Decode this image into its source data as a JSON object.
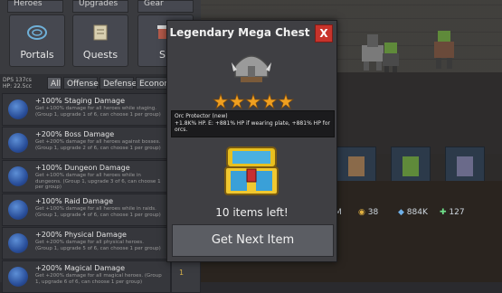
{
  "nav": {
    "top": [
      "Heroes",
      "Upgrades",
      "Gear"
    ],
    "tiles": [
      {
        "label": "Portals",
        "icon": "portal-icon"
      },
      {
        "label": "Quests",
        "icon": "scroll-icon"
      },
      {
        "label": "Sh",
        "icon": "shop-icon"
      }
    ]
  },
  "stats": {
    "l1": "DPS",
    "v1": "137cs",
    "l2": "HP:",
    "v2": "22.5cc"
  },
  "filters": [
    "All",
    "Offense",
    "Defense",
    "Economi"
  ],
  "upgrades": [
    {
      "title": "+100% Staging Damage",
      "desc": "Get +100% damage for all heroes while staging. (Group 1, upgrade 1 of 6, can choose 1 per group)"
    },
    {
      "title": "+200% Boss Damage",
      "desc": "Get +200% damage for all heroes against bosses. (Group 1, upgrade 2 of 6, can choose 1 per group)"
    },
    {
      "title": "+100% Dungeon Damage",
      "desc": "Get +100% damage for all heroes while in dungeons. (Group 1, upgrade 3 of 6, can choose 1 per group)"
    },
    {
      "title": "+100% Raid Damage",
      "desc": "Get +100% damage for all heroes while in raids. (Group 1, upgrade 4 of 6, can choose 1 per group)"
    },
    {
      "title": "+200% Physical Damage",
      "desc": "Get +200% damage for all physical heroes. (Group 1, upgrade 5 of 6, can choose 1 per group)"
    },
    {
      "title": "+200% Magical Damage",
      "desc": "Get +200% damage for all magical heroes. (Group 1, upgrade 6 of 6, can choose 1 per group)"
    }
  ],
  "side_value": "1",
  "resources": {
    "gold": "38",
    "gems": "884K",
    "people": "127",
    "m": "M"
  },
  "modal": {
    "title": "Legendary Mega Chest",
    "close": "X",
    "stars": 5,
    "item_name": "Orc Protector (new)",
    "item_effect": "+1.8K% HP. E: +881% HP if wearing plate, +881% HP for orcs.",
    "items_left": "10 items left!",
    "button": "Get Next Item"
  },
  "colors": {
    "close": "#c8332b",
    "star": "#f0a020",
    "hp": "#3ca04a"
  }
}
